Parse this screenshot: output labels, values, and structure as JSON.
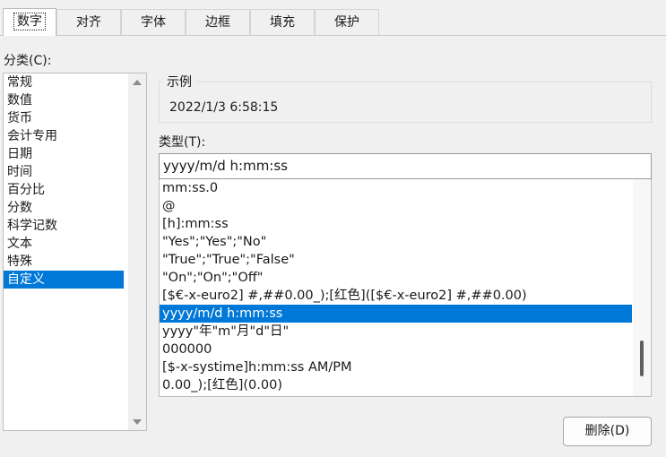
{
  "tabs": [
    {
      "label": "数字",
      "active": true
    },
    {
      "label": "对齐"
    },
    {
      "label": "字体"
    },
    {
      "label": "边框"
    },
    {
      "label": "填充"
    },
    {
      "label": "保护"
    }
  ],
  "category": {
    "label": "分类(C):",
    "items": [
      "常规",
      "数值",
      "货币",
      "会计专用",
      "日期",
      "时间",
      "百分比",
      "分数",
      "科学记数",
      "文本",
      "特殊",
      "自定义"
    ],
    "selected": "自定义"
  },
  "sample": {
    "legend": "示例",
    "value": "2022/1/3 6:58:15"
  },
  "type": {
    "label": "类型(T):",
    "value": "yyyy/m/d h:mm:ss",
    "items": [
      "mm:ss.0",
      "@",
      "[h]:mm:ss",
      "\"Yes\";\"Yes\";\"No\"",
      "\"True\";\"True\";\"False\"",
      "\"On\";\"On\";\"Off\"",
      "[$€-x-euro2] #,##0.00_);[红色]([$€-x-euro2] #,##0.00)",
      "yyyy/m/d h:mm:ss",
      "yyyy\"年\"m\"月\"d\"日\"",
      "000000",
      "[$-x-systime]h:mm:ss AM/PM",
      "0.00_);[红色](0.00)"
    ],
    "selected": "yyyy/m/d h:mm:ss"
  },
  "delete_button": "删除(D)",
  "colors": {
    "selection": "#0078d7",
    "background": "#f0f0f0"
  }
}
